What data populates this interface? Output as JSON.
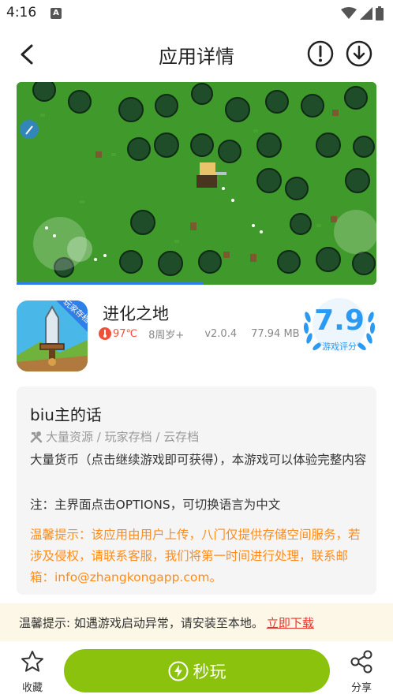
{
  "status": {
    "time": "4:16",
    "notif_letter": "A"
  },
  "header": {
    "title": "应用详情"
  },
  "app": {
    "name": "进化之地",
    "icon_badge": "玩家存档",
    "heat": "97℃",
    "age": "8周岁+",
    "version": "v2.0.4",
    "size": "77.94 MB",
    "score": "7.9",
    "score_label": "游戏评分"
  },
  "card": {
    "title": "biu主的话",
    "tags": "大量资源 / 玩家存档 / 云存档",
    "description": "大量货币（点击继续游戏即可获得），本游戏可以体验完整内容",
    "note": "注：主界面点击OPTIONS，可切换语言为中文",
    "warning": "温馨提示：该应用由用户上传，八门仅提供存储空间服务，若涉及侵权，请联系客服，我们将第一时间进行处理，联系邮箱：info@zhangkongapp.com。"
  },
  "tip": {
    "text": "温馨提示: 如遇游戏启动异常，请安装至本地。",
    "link": "立即下载"
  },
  "bottom": {
    "favorite": "收藏",
    "play": "秒玩",
    "share": "分享"
  },
  "colors": {
    "accent_blue": "#2b9af3",
    "play_green": "#8ac20e",
    "warn_orange": "#ff8c1a",
    "link_red": "#e8332a"
  }
}
